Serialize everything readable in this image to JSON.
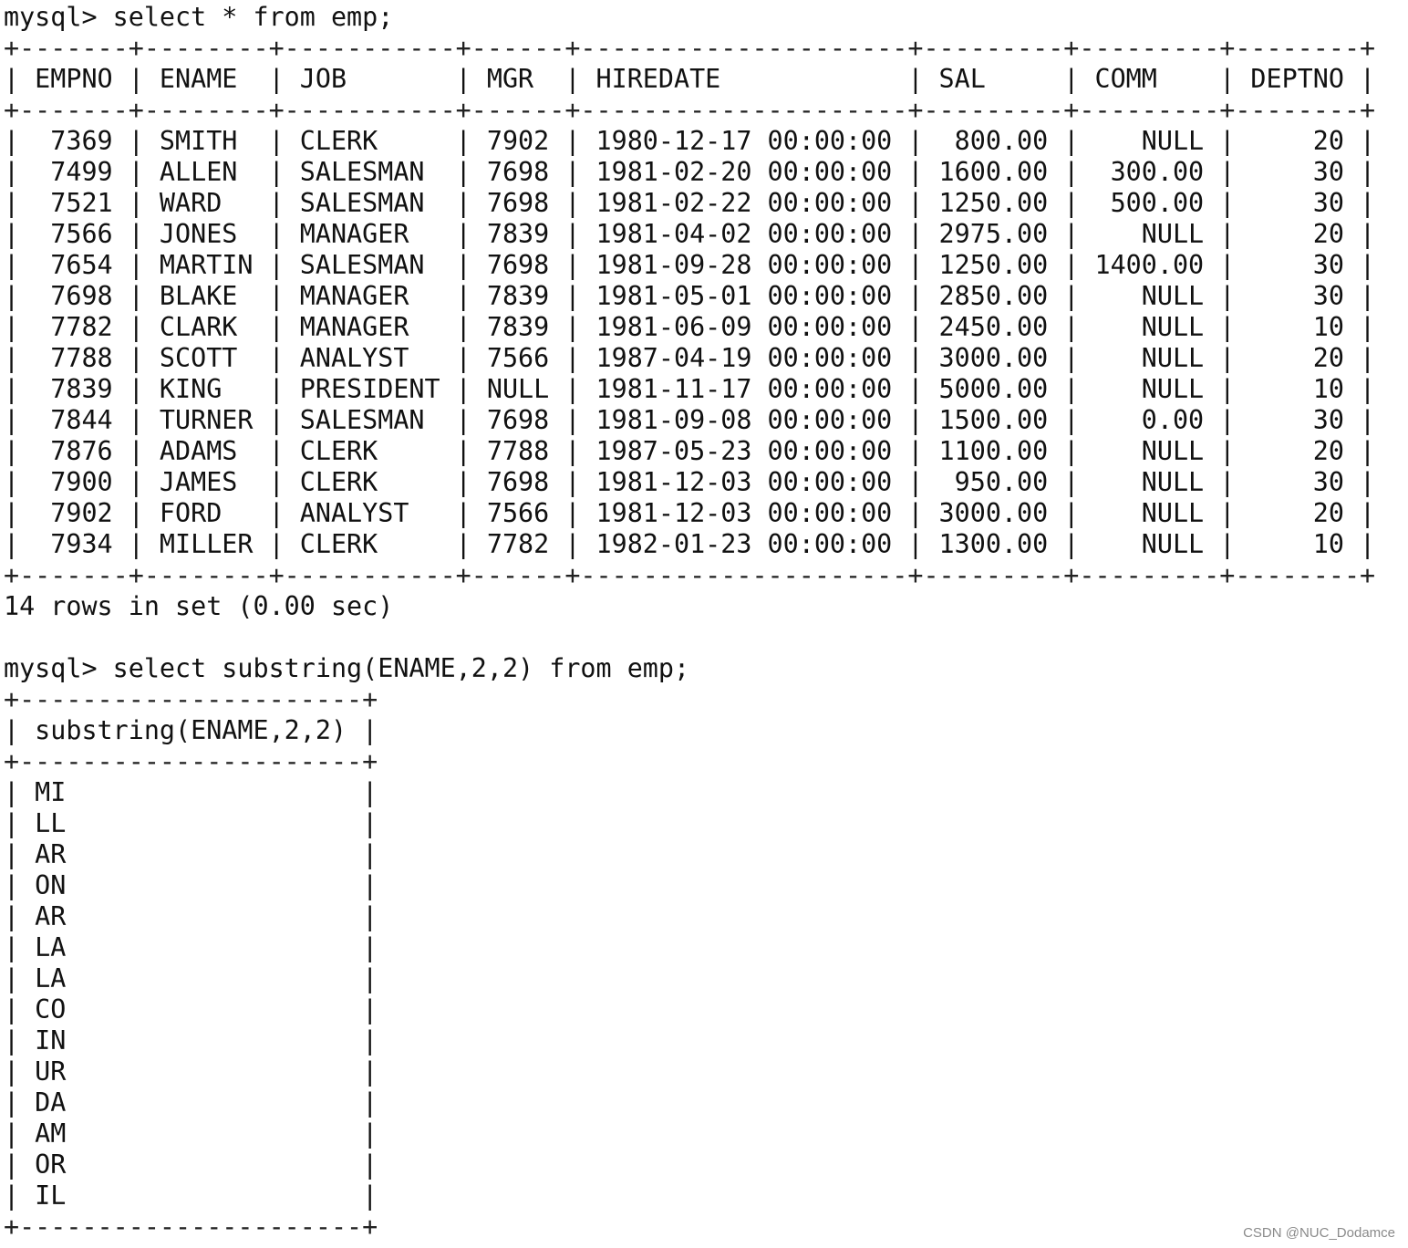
{
  "session": {
    "prompt": "mysql>",
    "queries": [
      {
        "command": "select * from emp;",
        "columns": [
          {
            "name": "EMPNO",
            "align": "right"
          },
          {
            "name": "ENAME",
            "align": "left"
          },
          {
            "name": "JOB",
            "align": "left"
          },
          {
            "name": "MGR",
            "align": "right"
          },
          {
            "name": "HIREDATE",
            "align": "left"
          },
          {
            "name": "SAL",
            "align": "right"
          },
          {
            "name": "COMM",
            "align": "right"
          },
          {
            "name": "DEPTNO",
            "align": "right"
          }
        ],
        "rows": [
          [
            "7369",
            "SMITH",
            "CLERK",
            "7902",
            "1980-12-17 00:00:00",
            "800.00",
            "NULL",
            "20"
          ],
          [
            "7499",
            "ALLEN",
            "SALESMAN",
            "7698",
            "1981-02-20 00:00:00",
            "1600.00",
            "300.00",
            "30"
          ],
          [
            "7521",
            "WARD",
            "SALESMAN",
            "7698",
            "1981-02-22 00:00:00",
            "1250.00",
            "500.00",
            "30"
          ],
          [
            "7566",
            "JONES",
            "MANAGER",
            "7839",
            "1981-04-02 00:00:00",
            "2975.00",
            "NULL",
            "20"
          ],
          [
            "7654",
            "MARTIN",
            "SALESMAN",
            "7698",
            "1981-09-28 00:00:00",
            "1250.00",
            "1400.00",
            "30"
          ],
          [
            "7698",
            "BLAKE",
            "MANAGER",
            "7839",
            "1981-05-01 00:00:00",
            "2850.00",
            "NULL",
            "30"
          ],
          [
            "7782",
            "CLARK",
            "MANAGER",
            "7839",
            "1981-06-09 00:00:00",
            "2450.00",
            "NULL",
            "10"
          ],
          [
            "7788",
            "SCOTT",
            "ANALYST",
            "7566",
            "1987-04-19 00:00:00",
            "3000.00",
            "NULL",
            "20"
          ],
          [
            "7839",
            "KING",
            "PRESIDENT",
            "NULL",
            "1981-11-17 00:00:00",
            "5000.00",
            "NULL",
            "10"
          ],
          [
            "7844",
            "TURNER",
            "SALESMAN",
            "7698",
            "1981-09-08 00:00:00",
            "1500.00",
            "0.00",
            "30"
          ],
          [
            "7876",
            "ADAMS",
            "CLERK",
            "7788",
            "1987-05-23 00:00:00",
            "1100.00",
            "NULL",
            "20"
          ],
          [
            "7900",
            "JAMES",
            "CLERK",
            "7698",
            "1981-12-03 00:00:00",
            "950.00",
            "NULL",
            "30"
          ],
          [
            "7902",
            "FORD",
            "ANALYST",
            "7566",
            "1981-12-03 00:00:00",
            "3000.00",
            "NULL",
            "20"
          ],
          [
            "7934",
            "MILLER",
            "CLERK",
            "7782",
            "1982-01-23 00:00:00",
            "1300.00",
            "NULL",
            "10"
          ]
        ],
        "footer": "14 rows in set (0.00 sec)"
      },
      {
        "command": "select substring(ENAME,2,2) from emp;",
        "columns": [
          {
            "name": "substring(ENAME,2,2)",
            "align": "left"
          }
        ],
        "rows": [
          [
            "MI"
          ],
          [
            "LL"
          ],
          [
            "AR"
          ],
          [
            "ON"
          ],
          [
            "AR"
          ],
          [
            "LA"
          ],
          [
            "LA"
          ],
          [
            "CO"
          ],
          [
            "IN"
          ],
          [
            "UR"
          ],
          [
            "DA"
          ],
          [
            "AM"
          ],
          [
            "OR"
          ],
          [
            "IL"
          ]
        ],
        "footer": ""
      }
    ]
  },
  "watermark": "CSDN @NUC_Dodamce"
}
